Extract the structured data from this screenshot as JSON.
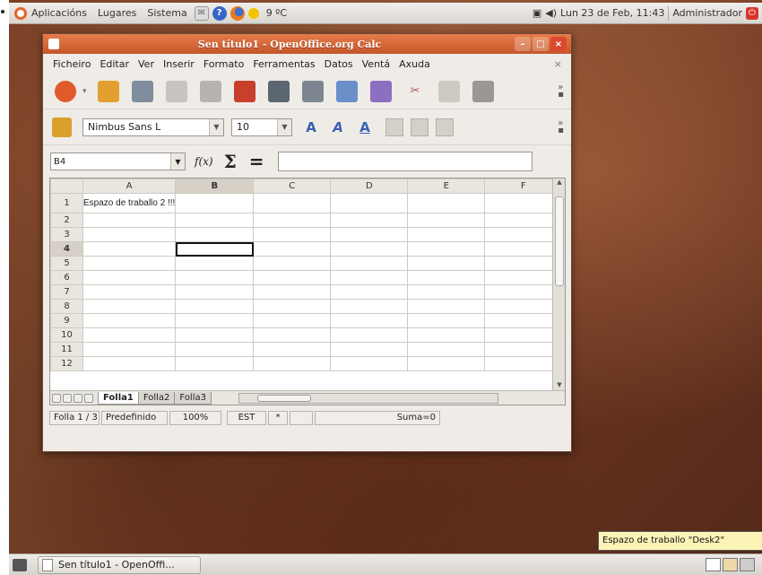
{
  "top_panel": {
    "menus": [
      "Aplicacións",
      "Lugares",
      "Sistema"
    ],
    "weather": "9 ºC",
    "clock": "Lun 23 de Feb, 11:43",
    "user": "Administrador"
  },
  "window": {
    "title": "Sen título1 - OpenOffice.org Calc",
    "menu": [
      "Ficheiro",
      "Editar",
      "Ver",
      "Inserir",
      "Formato",
      "Ferramentas",
      "Datos",
      "Ventá",
      "Axuda"
    ],
    "font_name": "Nimbus Sans L",
    "font_size": "10",
    "name_box": "B4",
    "formula_value": "",
    "columns": [
      "A",
      "B",
      "C",
      "D",
      "E",
      "F"
    ],
    "rows": [
      "1",
      "2",
      "3",
      "4",
      "5",
      "6",
      "7",
      "8",
      "9",
      "10",
      "11",
      "12"
    ],
    "cell_a1": "Espazo de traballo 2 !!!",
    "sheet_tabs": [
      "Folla1",
      "Folla2",
      "Folla3"
    ],
    "status": {
      "sheet": "Folla 1 / 3",
      "style": "Predefinido",
      "zoom": "100%",
      "mode": "EST",
      "modified": "*",
      "sum": "Suma=0"
    }
  },
  "bottom_panel": {
    "task_label": "Sen título1 - OpenOffi...",
    "workspace_tooltip": "Espazo de traballo \"Desk2\""
  }
}
